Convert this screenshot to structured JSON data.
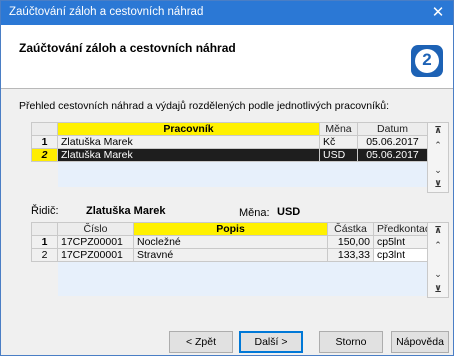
{
  "window": {
    "title": "Zaúčtování záloh a cestovních náhrad",
    "close_glyph": "✕"
  },
  "header": {
    "title": "Zaúčtování záloh a cestovních náhrad",
    "logo_glyph": "2"
  },
  "description": "Přehled cestovních náhrad a výdajů rozdělených podle jednotlivých pracovníků:",
  "top_grid": {
    "columns": [
      "Pracovník",
      "Měna",
      "Datum"
    ],
    "rows": [
      {
        "num": "1",
        "name": "Zlatuška Marek",
        "currency": "Kč",
        "date": "05.06.2017"
      },
      {
        "num": "2",
        "name": "Zlatuška Marek",
        "currency": "USD",
        "date": "05.06.2017"
      }
    ]
  },
  "driver": {
    "label": "Řidič:",
    "value": "Zlatuška Marek",
    "currency_label": "Měna:",
    "currency_value": "USD"
  },
  "bottom_grid": {
    "columns": [
      "Číslo",
      "Popis",
      "Částka",
      "Předkontace"
    ],
    "rows": [
      {
        "num": "1",
        "code": "17CPZ00001",
        "desc": "Nocležné",
        "amount": "150,00",
        "prekont": "cp5lnt"
      },
      {
        "num": "2",
        "code": "17CPZ00001",
        "desc": "Stravné",
        "amount": "133,33",
        "prekont": "cp3lnt"
      }
    ]
  },
  "scroll": {
    "top": "⊼",
    "up": "⌃",
    "down": "⌄",
    "bottom": "⊻"
  },
  "buttons": {
    "back": "< Zpět",
    "next": "Další >",
    "cancel": "Storno",
    "help": "Nápověda"
  }
}
